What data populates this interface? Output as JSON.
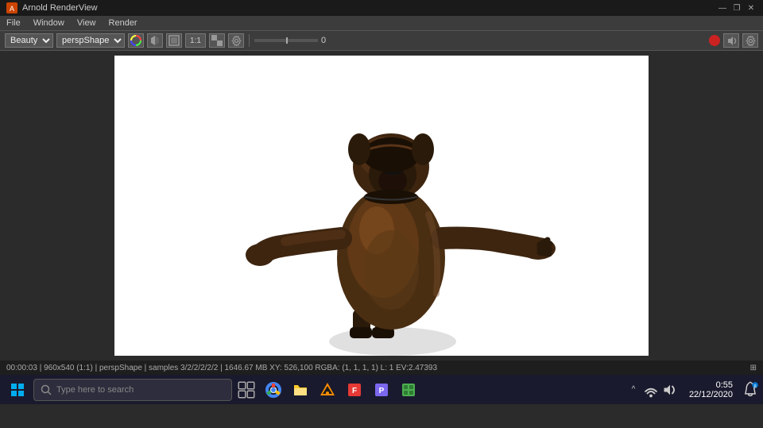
{
  "titlebar": {
    "title": "Arnold RenderView",
    "minimize": "—",
    "restore": "❐",
    "close": "✕"
  },
  "menubar": {
    "items": [
      "File",
      "Window",
      "View",
      "Render"
    ]
  },
  "toolbar": {
    "beauty_label": "Beauty",
    "camera_label": "perspShape",
    "ratio_label": "1:1",
    "slider_value": "0"
  },
  "status": {
    "text": "00:00:03 | 960x540 (1:1) | perspShape | samples 3/2/2/2/2/2 | 1646.67 MB XY: 526,100   RGBA: (1, 1, 1, 1)       L: 1    EV:2.47393",
    "icon": "⊞"
  },
  "taskbar": {
    "search_placeholder": "Type here to search",
    "clock_time": "0:55",
    "clock_date": "22/12/2020",
    "apps": [
      {
        "name": "chrome",
        "color": "#4285F4"
      },
      {
        "name": "file-explorer",
        "color": "#FFCA28"
      },
      {
        "name": "vlc",
        "color": "#FF8C00"
      },
      {
        "name": "files",
        "color": "#E53935"
      },
      {
        "name": "app5",
        "color": "#7B68EE"
      },
      {
        "name": "minecraft",
        "color": "#4CAF50"
      }
    ]
  }
}
